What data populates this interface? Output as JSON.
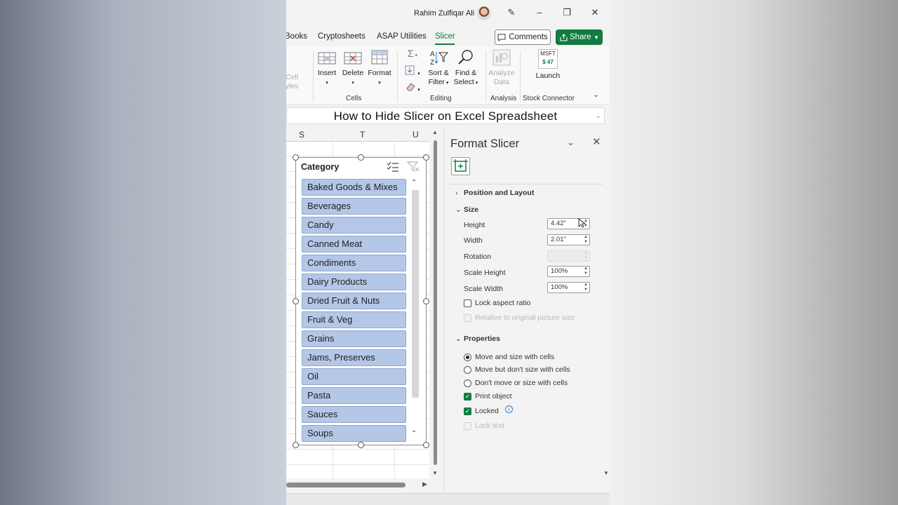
{
  "window": {
    "user_name": "Rahim Zulfiqar Ali"
  },
  "tabs": {
    "items": [
      "Books",
      "Cryptosheets",
      "ASAP Utilities",
      "Slicer"
    ],
    "active": "Slicer",
    "comments_label": "Comments",
    "share_label": "Share"
  },
  "ribbon": {
    "cell_styles_label_1": "Cell",
    "cell_styles_label_2": "yles",
    "insert_label": "Insert",
    "delete_label": "Delete",
    "format_label": "Format",
    "cells_group": "Cells",
    "sort_label_1": "Sort &",
    "sort_label_2": "Filter",
    "find_label_1": "Find &",
    "find_label_2": "Select",
    "editing_group": "Editing",
    "analyze_label_1": "Analyze",
    "analyze_label_2": "Data",
    "analysis_group": "Analysis",
    "ticker_symbol": "MSFT",
    "ticker_price": "$ 47",
    "launch_label": "Launch",
    "stock_group": "Stock Connector"
  },
  "banner_text": "How to Hide Slicer on Excel Spreadsheet",
  "grid": {
    "columns": [
      "S",
      "T",
      "U"
    ]
  },
  "slicer": {
    "title": "Category",
    "items": [
      "Baked Goods & Mixes",
      "Beverages",
      "Candy",
      "Canned Meat",
      "Condiments",
      "Dairy Products",
      "Dried Fruit & Nuts",
      "Fruit & Veg",
      "Grains",
      "Jams, Preserves",
      "Oil",
      "Pasta",
      "Sauces",
      "Soups"
    ],
    "item_color": "#b4c7e7"
  },
  "format_pane": {
    "title": "Format Slicer",
    "position_layout": "Position and Layout",
    "size_section": "Size",
    "height_label": "Height",
    "height_value": "4.42\"",
    "width_label": "Width",
    "width_value": "2.01\"",
    "rotation_label": "Rotation",
    "scale_height_label": "Scale Height",
    "scale_height_value": "100%",
    "scale_width_label": "Scale Width",
    "scale_width_value": "100%",
    "lock_aspect": "Lock aspect ratio",
    "relative_original": "Relative to original picture size",
    "properties_section": "Properties",
    "move_size": "Move and size with cells",
    "move_no_size": "Move but don't size with cells",
    "dont_move": "Don't move or size with cells",
    "print_object": "Print object",
    "locked": "Locked",
    "lock_text": "Lock text"
  },
  "colors": {
    "excel_green": "#107c41"
  }
}
